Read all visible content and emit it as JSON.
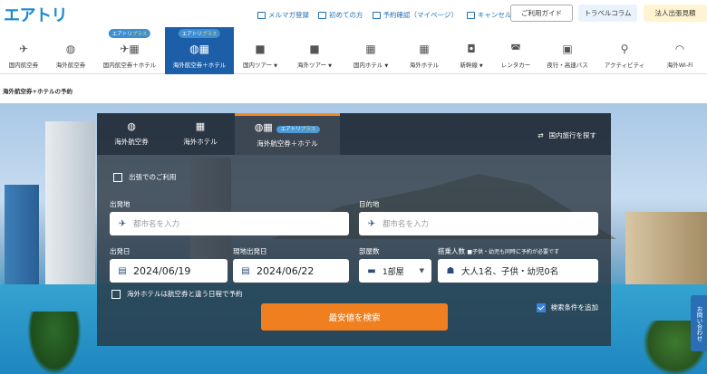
{
  "brand": {
    "logo": "エアトリ"
  },
  "top_links": [
    {
      "label": "メルマガ登録",
      "icon": "mail-icon"
    },
    {
      "label": "初めての方",
      "icon": "beginner-icon"
    },
    {
      "label": "予約確認（マイページ）",
      "icon": "calendar-icon"
    },
    {
      "label": "キャンセル受付",
      "icon": "calendar-x-icon"
    }
  ],
  "top_buttons": {
    "guide": "ご利用ガイド",
    "column": "トラベルコラム",
    "corporate": "法人出張見積"
  },
  "nav": {
    "plus_badge": "エアトリプラス",
    "plus_badge_word": "エアトリ",
    "plus_badge_suffix": "プラス",
    "items": [
      {
        "label": "国内航空券",
        "icon": "plane-icon"
      },
      {
        "label": "海外航空券",
        "icon": "globe-plane-icon"
      },
      {
        "label": "国内航空券＋ホテル",
        "icon": "plane-hotel-icon"
      },
      {
        "label": "海外航空券＋ホテル",
        "icon": "globe-hotel-icon"
      },
      {
        "label": "国内ツアー",
        "icon": "suitcase-icon"
      },
      {
        "label": "海外ツアー",
        "icon": "suitcase-icon"
      },
      {
        "label": "国内ホテル",
        "icon": "building-icon"
      },
      {
        "label": "海外ホテル",
        "icon": "building-icon"
      },
      {
        "label": "新幹線",
        "icon": "train-icon"
      },
      {
        "label": "レンタカー",
        "icon": "car-icon"
      },
      {
        "label": "夜行・高速バス",
        "icon": "bus-icon"
      },
      {
        "label": "アクティビティ",
        "icon": "activity-icon"
      },
      {
        "label": "海外Wi-Fi",
        "icon": "wifi-icon"
      }
    ]
  },
  "breadcrumb": "海外航空券+ホテルの予約",
  "search": {
    "tabs": [
      {
        "label": "海外航空券",
        "icon": "globe-plane-icon"
      },
      {
        "label": "海外ホテル",
        "icon": "building-icon"
      },
      {
        "label": "海外航空券＋ホテル",
        "icon": "globe-hotel-icon",
        "badge": "エアトリプラス"
      }
    ],
    "domestic_link": "国内旅行を探す",
    "business_trip": "出張でのご利用",
    "origin_label": "出発地",
    "origin_placeholder": "都市名を入力",
    "destination_label": "目的地",
    "destination_placeholder": "都市名を入力",
    "depart_label": "出発日",
    "depart_value": "2024/06/19",
    "local_depart_label": "現地出発日",
    "local_depart_value": "2024/06/22",
    "rooms_label": "部屋数",
    "rooms_value": "1部屋",
    "guests_label": "搭乗人数",
    "guests_note": "■子供・幼児も同時に予約が必要です",
    "guests_value": "大人1名、子供・幼児0名",
    "different_dates": "海外ホテルは航空券と違う日程で予約",
    "search_button": "最安値を検索",
    "add_conditions": "検索条件を追加"
  },
  "inquiry": "お問い合わせ",
  "colors": {
    "accent": "#1c5fa8",
    "search_button": "#f07f1f",
    "link": "#1f6fb0"
  }
}
